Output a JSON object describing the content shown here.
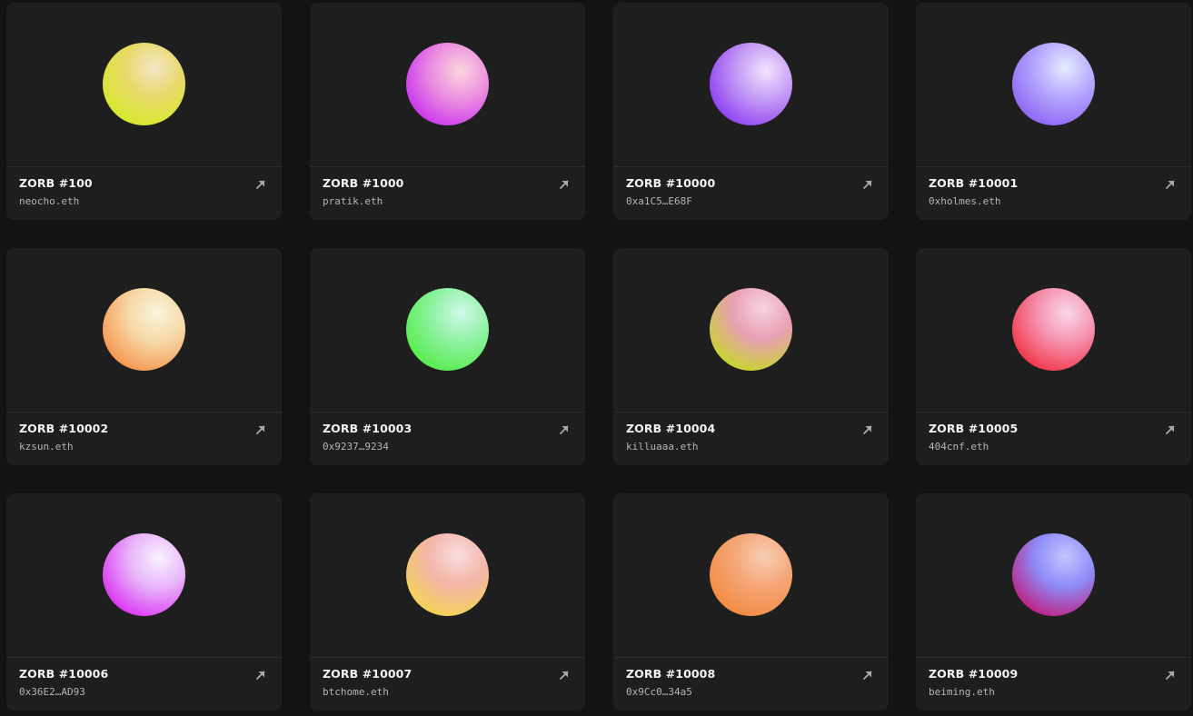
{
  "cards": [
    {
      "title": "ZORB #100",
      "owner": "neocho.eth",
      "orb": {
        "hi": "#f5e6c8",
        "mid": "#e8d96a",
        "base": "#d6ea26",
        "hx": "62%",
        "hy": "30%"
      }
    },
    {
      "title": "ZORB #1000",
      "owner": "pratik.eth",
      "orb": {
        "hi": "#fbd6de",
        "mid": "#ec8fe0",
        "base": "#c830ee",
        "hx": "66%",
        "hy": "34%"
      }
    },
    {
      "title": "ZORB #10000",
      "owner": "0xa1C5…E68F",
      "orb": {
        "hi": "#f3e4ff",
        "mid": "#c49af6",
        "base": "#8c3bf0",
        "hx": "68%",
        "hy": "34%"
      }
    },
    {
      "title": "ZORB #10001",
      "owner": "0xholmes.eth",
      "orb": {
        "hi": "#e5ecff",
        "mid": "#b6a8ff",
        "base": "#8c62f4",
        "hx": "64%",
        "hy": "30%"
      }
    },
    {
      "title": "ZORB #10002",
      "owner": "kzsun.eth",
      "orb": {
        "hi": "#faf5dc",
        "mid": "#f6d7a4",
        "base": "#f5924a",
        "hx": "66%",
        "hy": "30%"
      }
    },
    {
      "title": "ZORB #10003",
      "owner": "0x9237…9234",
      "orb": {
        "hi": "#d2f8ec",
        "mid": "#8ef2a0",
        "base": "#52ec48",
        "hx": "66%",
        "hy": "30%"
      }
    },
    {
      "title": "ZORB #10004",
      "owner": "killuaaa.eth",
      "orb": {
        "hi": "#f8d3de",
        "mid": "#e8a0b4",
        "base": "#c7d62a",
        "hx": "64%",
        "hy": "24%"
      }
    },
    {
      "title": "ZORB #10005",
      "owner": "404cnf.eth",
      "orb": {
        "hi": "#fad8ec",
        "mid": "#f591ad",
        "base": "#f03244",
        "hx": "66%",
        "hy": "30%"
      }
    },
    {
      "title": "ZORB #10006",
      "owner": "0x36E2…AD93",
      "orb": {
        "hi": "#faf2ff",
        "mid": "#e8b2fa",
        "base": "#da2ef2",
        "hx": "68%",
        "hy": "30%"
      }
    },
    {
      "title": "ZORB #10007",
      "owner": "btchome.eth",
      "orb": {
        "hi": "#f9dede",
        "mid": "#f3b5a8",
        "base": "#f3d452",
        "hx": "62%",
        "hy": "26%"
      }
    },
    {
      "title": "ZORB #10008",
      "owner": "0x9Cc0…34a5",
      "orb": {
        "hi": "#f6cfb6",
        "mid": "#f5a676",
        "base": "#f38a40",
        "hx": "66%",
        "hy": "28%"
      }
    },
    {
      "title": "ZORB #10009",
      "owner": "beiming.eth",
      "orb": {
        "hi": "#c2c6ff",
        "mid": "#8e8cf8",
        "base": "#c01c7e",
        "hx": "64%",
        "hy": "28%"
      }
    }
  ]
}
